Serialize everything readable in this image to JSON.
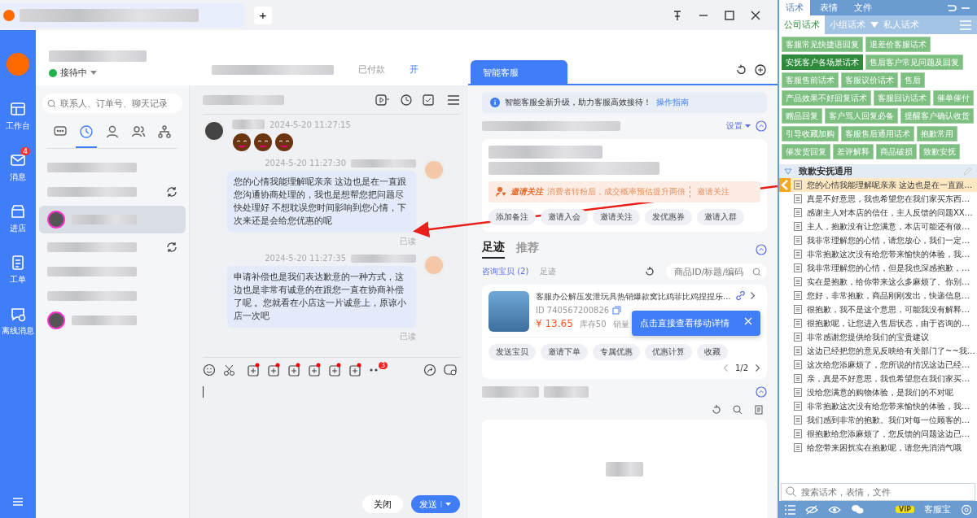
{
  "top_bar": {
    "new_tab_label": "+"
  },
  "nav": [
    {
      "kind": "desk",
      "label": "工作台",
      "selected": false
    },
    {
      "kind": "mail",
      "label": "消息",
      "badge": "4",
      "selected": false
    },
    {
      "kind": "store",
      "label": "进店",
      "selected": false
    },
    {
      "kind": "list",
      "label": "工单",
      "selected": false
    },
    {
      "kind": "offline",
      "label": "离线消息",
      "selected": false
    }
  ],
  "status": "接待中",
  "header_tabs": [
    {
      "label": "已付款"
    },
    {
      "label": "开",
      "kind": "link"
    }
  ],
  "search": {
    "placeholder": "联系人、订单号、聊天记录"
  },
  "contact_tabs": [
    {
      "kind": "chat",
      "selected": false
    },
    {
      "kind": "clock",
      "selected": true
    },
    {
      "kind": "person",
      "selected": false
    },
    {
      "kind": "people",
      "selected": false
    },
    {
      "kind": "org",
      "selected": false
    }
  ],
  "contacts": [
    {
      "kind": "group",
      "selected": false
    },
    {
      "kind": "group",
      "sync": true,
      "selected": false
    },
    {
      "kind": "chat",
      "selected": true
    },
    {
      "kind": "group",
      "sync": true,
      "selected": false
    },
    {
      "kind": "group",
      "selected": false
    },
    {
      "kind": "group",
      "selected": false
    },
    {
      "kind": "chat",
      "selected": false
    }
  ],
  "messages": [
    {
      "from_customer": true,
      "kind": "stickers",
      "time": "2024-5-20 11:27:15"
    },
    {
      "from_customer": false,
      "kind": "text",
      "time": "2024-5-20 11:27:30",
      "text": "您的心情我能理解呢亲亲 这边也是在一直跟您沟通协商处理的，我也是想帮您把问题尽快处理好 不想耽误您时间影响到您心情，下次来还是会给您优惠的呢",
      "status": "已读"
    },
    {
      "from_customer": false,
      "kind": "text",
      "time": "2024-5-20 11:27:35",
      "text": "申请补偿也是我们表达歉意的一种方式，这边也是非常有诚意的在跟您一直在协商补偿了呢 。您就看在小店这一片诚意上，原谅小店一次吧",
      "status": "已读"
    }
  ],
  "more_tools_badge": "3",
  "buttons": {
    "close": "关闭",
    "send": "发送"
  },
  "assistant": {
    "tab": "智能客服",
    "notice": "智能客服全新升级，助力客服高效接待！",
    "notice_link": "操作指南",
    "settings": "设置",
    "promo": {
      "title": "邀请关注",
      "text": "消费者转粉后，成交概率预估提升两倍",
      "action": "邀请关注"
    },
    "actions": [
      "添加备注",
      "邀请入会",
      "邀请关注",
      "发优惠券",
      "邀请入群"
    ],
    "tabs": [
      {
        "label": "足迹",
        "selected": true
      },
      {
        "label": "推荐",
        "selected": false
      }
    ],
    "subtabs": [
      {
        "label": "咨询宝贝 (2)",
        "selected": true
      },
      {
        "label": "足迹",
        "selected": false
      }
    ],
    "product_search": {
      "placeholder": "商品ID/标题/编码"
    },
    "product": {
      "title": "客服办公解压发泄玩具热销爆款窝比鸡菲比鸡捏捏乐...",
      "id": "ID 740567200826",
      "price": "¥ 13.65",
      "stock": "库存50",
      "sales": "销量"
    },
    "tooltip": "点击直接查看移动详情",
    "product_actions": [
      "发送宝贝",
      "邀请下单",
      "专属优惠",
      "优惠计算",
      "收藏"
    ],
    "pager": "1/2"
  },
  "scripts": {
    "tabs": [
      {
        "label": "话术",
        "selected": true
      },
      {
        "label": "表情",
        "selected": false
      },
      {
        "label": "文件",
        "selected": false
      }
    ],
    "subtabs": [
      {
        "label": "公司话术",
        "selected": true
      },
      {
        "label": "小组话术",
        "dropdown": true,
        "selected": false
      },
      {
        "label": "私人话术",
        "selected": false
      }
    ],
    "categories": [
      {
        "label": "客服常见快捷语回复",
        "selected": false
      },
      {
        "label": "退差价客服话术",
        "selected": false
      },
      {
        "label": "安抚客户各场景话术",
        "selected": true
      },
      {
        "label": "售后客户常见问题及回复",
        "selected": false
      },
      {
        "label": "客服售前话术",
        "selected": false
      },
      {
        "label": "客服议价话术",
        "selected": false
      },
      {
        "label": "售后",
        "selected": false
      },
      {
        "label": "产品效果不好回复话术",
        "selected": false
      },
      {
        "label": "客服回访话术",
        "selected": false
      },
      {
        "label": "催单催付",
        "selected": false
      },
      {
        "label": "赠品回复",
        "selected": false
      },
      {
        "label": "客户骂人回复必备",
        "selected": false
      },
      {
        "label": "提醒客户确认收货",
        "selected": false
      },
      {
        "label": "引导收藏加购",
        "selected": false
      },
      {
        "label": "客服售后通用话术",
        "selected": false
      },
      {
        "label": "抱歉常用",
        "selected": false
      },
      {
        "label": "催发货回复",
        "selected": false
      },
      {
        "label": "差评解释",
        "selected": false
      },
      {
        "label": "商品破损",
        "selected": false
      },
      {
        "label": "致歉安抚",
        "selected": false
      }
    ],
    "group": "致歉安抚通用",
    "items": [
      {
        "text": "您的心情我能理解呢亲亲 这边也是在一直跟…",
        "selected": true
      },
      {
        "text": "真是不好意思，我也希望您在我们家买东西…",
        "selected": false
      },
      {
        "text": "感谢主人对本店的信任，主人反馈的问题XX…",
        "selected": false
      },
      {
        "text": "主人，抱歉没有让您满意，本店可能还有做…",
        "selected": false
      },
      {
        "text": "我非常理解您的心情，请您放心，我们一定…",
        "selected": false
      },
      {
        "text": "非常抱歉这次没有给您带来愉快的体验，我…",
        "selected": false
      },
      {
        "text": "我非常理解您的心情，但是我也深感抱歉，…",
        "selected": false
      },
      {
        "text": "实在是抱歉，给你带来这么多麻烦了。你别…",
        "selected": false
      },
      {
        "text": "您好，非常抱歉，商品刚刚发出，快递信息…",
        "selected": false
      },
      {
        "text": "很抱歉，我不是这个意思，可能我没有解释…",
        "selected": false
      },
      {
        "text": "很抱歉呢，让您进入售后状态，由于咨询的…",
        "selected": false
      },
      {
        "text": "非常感谢您提供给我们的宝贵建议",
        "selected": false
      },
      {
        "text": "这边已经把您的意见反映给有关部门了~~我…",
        "selected": false
      },
      {
        "text": "这次给您添麻烦了，您所说的情况这边已经…",
        "selected": false
      },
      {
        "text": "亲，真是不好意思，我也希望您在我们家买…",
        "selected": false
      },
      {
        "text": "没给您满意的购物体验，是我们的不对呢",
        "selected": false
      },
      {
        "text": "非常抱歉这次没有给您带来愉快的体验，我…",
        "selected": false
      },
      {
        "text": "我们感到非常的抱歉。我们对每一位顾客的…",
        "selected": false
      },
      {
        "text": "很抱歉给您添麻烦了，您反馈的问题这边已…",
        "selected": false
      },
      {
        "text": "给您带来困扰实在抱歉呢，请您先消消气哦",
        "selected": false
      }
    ],
    "search": {
      "placeholder": "搜索话术，表情，文件"
    },
    "vip": "VIP",
    "brand": "客服宝"
  }
}
